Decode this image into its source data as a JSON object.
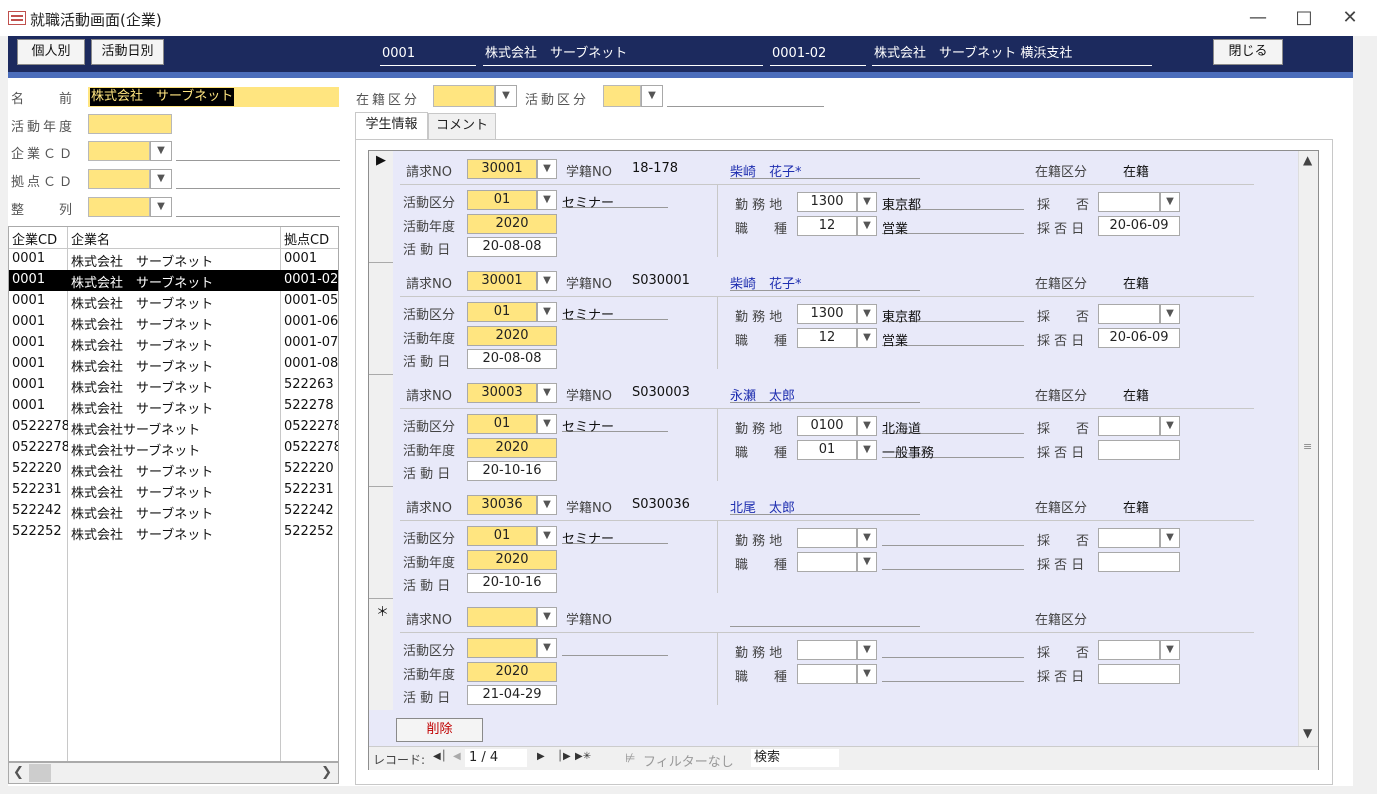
{
  "window": {
    "title": "就職活動画面(企業)"
  },
  "header": {
    "btn_individual": "個人別",
    "btn_activity_date": "活動日別",
    "company_cd": "0001",
    "company_name": "株式会社　サーブネット",
    "branch_cd": "0001-02",
    "branch_name": "株式会社　サーブネット 横浜支社",
    "btn_close": "閉じる"
  },
  "filters": {
    "name_label": "名　　前",
    "name_value": "株式会社　サーブネット",
    "year_label": "活動年度",
    "company_cd_label": "企業ＣＤ",
    "branch_cd_label": "拠点ＣＤ",
    "sort_label": "整　　列",
    "enroll_label": "在籍区分",
    "activity_label": "活動区分"
  },
  "list": {
    "headers": [
      "企業CD",
      "企業名",
      "拠点CD"
    ],
    "rows": [
      [
        "0001",
        "株式会社　サーブネット",
        "0001"
      ],
      [
        "0001",
        "株式会社　サーブネット",
        "0001-02"
      ],
      [
        "0001",
        "株式会社　サーブネット",
        "0001-05"
      ],
      [
        "0001",
        "株式会社　サーブネット",
        "0001-06"
      ],
      [
        "0001",
        "株式会社　サーブネット",
        "0001-07"
      ],
      [
        "0001",
        "株式会社　サーブネット",
        "0001-08"
      ],
      [
        "0001",
        "株式会社　サーブネット",
        "522263"
      ],
      [
        "0001",
        "株式会社　サーブネット",
        "522278"
      ],
      [
        "0522278",
        "株式会社サーブネット",
        "0522278"
      ],
      [
        "0522278",
        "株式会社サーブネット",
        "0522278"
      ],
      [
        "522220",
        "株式会社　サーブネット",
        "522220"
      ],
      [
        "522231",
        "株式会社　サーブネット",
        "522231"
      ],
      [
        "522242",
        "株式会社　サーブネット",
        "522242"
      ],
      [
        "522252",
        "株式会社　サーブネット",
        "522252"
      ]
    ],
    "selected_index": 1
  },
  "tabs": [
    "学生情報",
    "コメント"
  ],
  "labels": {
    "request_no": "請求NO",
    "student_no": "学籍NO",
    "enroll_kbn": "在籍区分",
    "activity_kbn": "活動区分",
    "activity_year": "活動年度",
    "activity_date": "活 動 日",
    "work_place": "勤 務 地",
    "job_type": "職　　種",
    "accept": "採　　否",
    "accept_date": "採 否 日"
  },
  "records": [
    {
      "marker": "▶",
      "request_no": "30001",
      "student_no": "18-178",
      "student_name": "柴崎　花子*",
      "enroll": "在籍",
      "act_kbn": "01",
      "act_name": "セミナー",
      "year": "2020",
      "date": "20-08-08",
      "work_cd": "1300",
      "work_name": "東京都",
      "job_cd": "12",
      "job_name": "営業",
      "accept_date": "20-06-09"
    },
    {
      "marker": "",
      "request_no": "30001",
      "student_no": "S030001",
      "student_name": "柴崎　花子*",
      "enroll": "在籍",
      "act_kbn": "01",
      "act_name": "セミナー",
      "year": "2020",
      "date": "20-08-08",
      "work_cd": "1300",
      "work_name": "東京都",
      "job_cd": "12",
      "job_name": "営業",
      "accept_date": "20-06-09"
    },
    {
      "marker": "",
      "request_no": "30003",
      "student_no": "S030003",
      "student_name": "永瀬　太郎",
      "enroll": "在籍",
      "act_kbn": "01",
      "act_name": "セミナー",
      "year": "2020",
      "date": "20-10-16",
      "work_cd": "0100",
      "work_name": "北海道",
      "job_cd": "01",
      "job_name": "一般事務",
      "accept_date": ""
    },
    {
      "marker": "",
      "request_no": "30036",
      "student_no": "S030036",
      "student_name": "北尾　太郎",
      "enroll": "在籍",
      "act_kbn": "01",
      "act_name": "セミナー",
      "year": "2020",
      "date": "20-10-16",
      "work_cd": "",
      "work_name": "",
      "job_cd": "",
      "job_name": "",
      "accept_date": ""
    },
    {
      "marker": "＊",
      "request_no": "",
      "student_no": "",
      "student_name": "",
      "enroll": "",
      "act_kbn": "",
      "act_name": "",
      "year": "2020",
      "date": "21-04-29",
      "work_cd": "",
      "work_name": "",
      "job_cd": "",
      "job_name": "",
      "accept_date": ""
    }
  ],
  "delete_button": "削除",
  "nav": {
    "label": "レコード:",
    "position": "1 / 4",
    "filter": "フィルターなし",
    "search": "検索"
  }
}
